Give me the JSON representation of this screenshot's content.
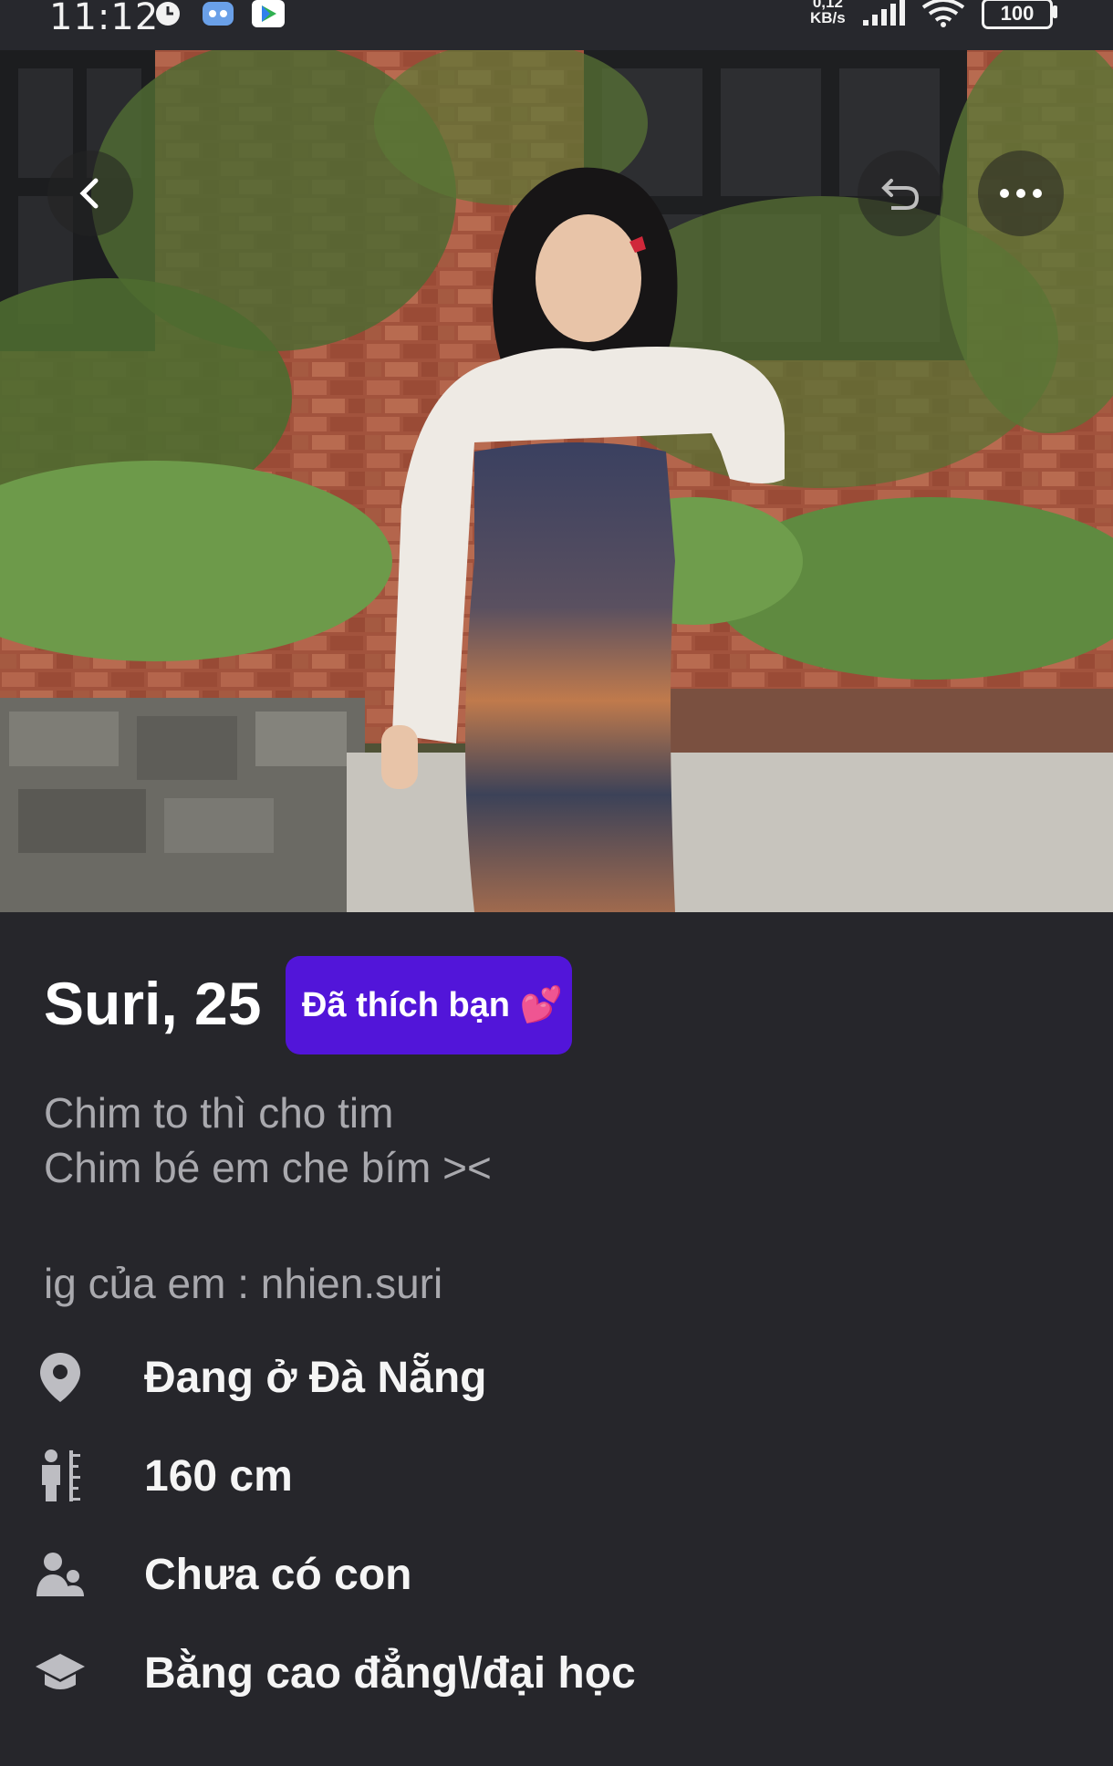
{
  "status_bar": {
    "time": "11:12",
    "net_speed_value": "0,12",
    "net_speed_unit": "KB/s",
    "battery": "100",
    "icons": [
      "alarm-icon",
      "app-notification-icon",
      "play-store-icon",
      "signal-icon",
      "wifi-icon",
      "battery-icon"
    ]
  },
  "photo": {
    "description_icons": [
      "back-icon",
      "undo-icon",
      "more-icon"
    ]
  },
  "profile": {
    "name_age": "Suri, 25",
    "liked_badge": "Đã thích bạn 💕",
    "bio_line1": "Chim to thì cho tim",
    "bio_line2": "Chim bé em che bím ><",
    "instagram": "ig của em : nhien.suri",
    "details": [
      {
        "icon": "location-pin-icon",
        "label": "Đang ở Đà Nẵng"
      },
      {
        "icon": "height-icon",
        "label": "160 cm"
      },
      {
        "icon": "children-icon",
        "label": "Chưa có con"
      },
      {
        "icon": "education-icon",
        "label": "Bằng cao đẳng\\/đại học"
      }
    ]
  },
  "colors": {
    "background": "#26262b",
    "badge": "#5215d9",
    "text_primary": "#ffffff",
    "text_secondary": "#a9a9ae"
  }
}
